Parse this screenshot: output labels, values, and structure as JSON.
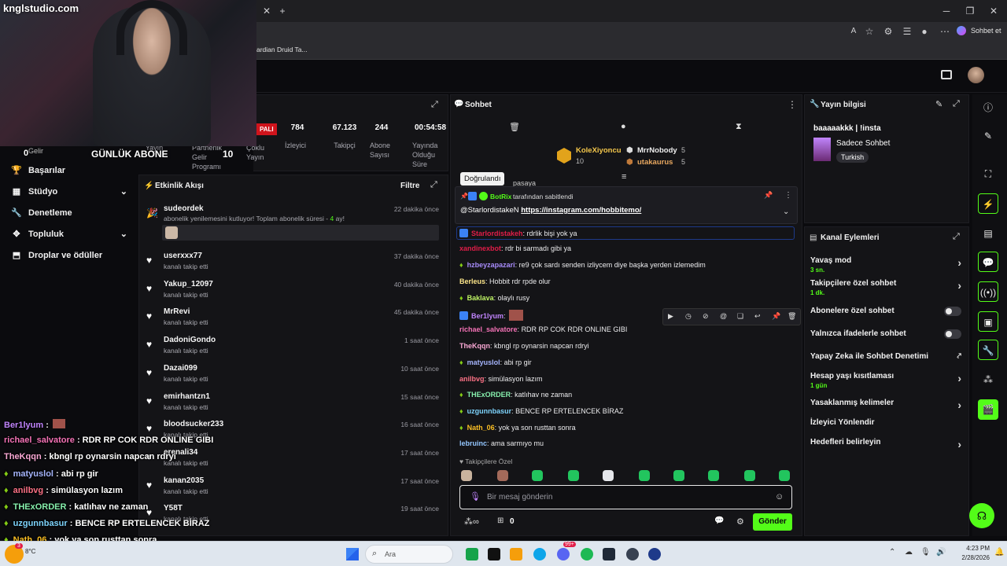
{
  "browser": {
    "bookmark_item": "ardian Druid Ta...",
    "copilot_label": "Sohbet et",
    "window_controls": [
      "minimize-icon",
      "restore-icon",
      "close-icon"
    ]
  },
  "overlay": {
    "brand": "knglstudio.com",
    "gunluk_abone_label": "GÜNLÜK ABONE",
    "gunluk_abone_count": "10",
    "left_counter": "0",
    "chat": [
      {
        "user": "Ber1lyum",
        "text": "",
        "color": "#c084fc"
      },
      {
        "user": "richael_salvatore",
        "text": "RDR RP COK RDR ONLINE GIBI",
        "color": "#f472b6"
      },
      {
        "user": "TheKqqn",
        "text": "kbngl rp oynarsin napcan rdryi",
        "color": "#f9a8d4"
      },
      {
        "user": "matyuslol",
        "text": "abi rp gir",
        "color": "#a5b4fc"
      },
      {
        "user": "anilbvg",
        "text": "simülasyon lazım",
        "color": "#fb7185"
      },
      {
        "user": "THExORDER",
        "text": "katlıhav ne zaman",
        "color": "#86efac"
      },
      {
        "user": "uzgunnbasur",
        "text": "BENCE RP ERTELENCEK BİRAZ",
        "color": "#7dd3fc"
      },
      {
        "user": "Nath_06",
        "text": "yok ya son rusttan sonra",
        "color": "#fbbf24"
      },
      {
        "user": "lebruinc",
        "text": "ama sarmıyo mu",
        "color": "#93c5fd"
      }
    ]
  },
  "stats": {
    "live_badge": "PALI",
    "items": [
      {
        "value": "784",
        "label": "İzleyici"
      },
      {
        "value": "67.123",
        "label": "Takipçi"
      },
      {
        "value": "244",
        "label": "Abone Sayısı"
      },
      {
        "value": "00:54:58",
        "label": "Yayında Olduğu Süre"
      }
    ],
    "partial_labels": [
      "Yayın",
      "Partnerlik Gelir Programı",
      "Çoklu Yayın",
      "Gelir"
    ]
  },
  "sidebar": {
    "items": [
      {
        "label": "Başarılar",
        "icon": "trophy-icon"
      },
      {
        "label": "Stüdyo",
        "icon": "studio-icon",
        "expand": true
      },
      {
        "label": "Denetleme",
        "icon": "wrench-icon"
      },
      {
        "label": "Topluluk",
        "icon": "community-icon",
        "expand": true
      },
      {
        "label": "Droplar ve ödüller",
        "icon": "drops-icon"
      }
    ]
  },
  "activity": {
    "title": "Etkinlik Akışı",
    "filter_label": "Filtre",
    "first": {
      "user": "sudeordek",
      "message": "abonelik yenilemesini kutluyor! Toplam abonelik süresi - ",
      "months": "4",
      "months_suffix": " ay!",
      "time": "22 dakika önce"
    },
    "items": [
      {
        "user": "userxxx77",
        "sub": "kanalı takip etti",
        "time": "37 dakika önce"
      },
      {
        "user": "Yakup_12097",
        "sub": "kanalı takip etti",
        "time": "40 dakika önce"
      },
      {
        "user": "MrRevi",
        "sub": "kanalı takip etti",
        "time": "45 dakika önce"
      },
      {
        "user": "DadoniGondo",
        "sub": "kanalı takip etti",
        "time": "1 saat önce"
      },
      {
        "user": "Dazai099",
        "sub": "kanalı takip etti",
        "time": "10 saat önce"
      },
      {
        "user": "emirhantzn1",
        "sub": "kanalı takip etti",
        "time": "15 saat önce"
      },
      {
        "user": "bloodsucker233",
        "sub": "kanalı takip etti",
        "time": "16 saat önce"
      },
      {
        "user": "erenali34",
        "sub": "kanalı takip etti",
        "time": "17 saat önce"
      },
      {
        "user": "kanan2035",
        "sub": "kanalı takip etti",
        "time": "17 saat önce"
      },
      {
        "user": "Y58T",
        "sub": "kanalı takip etti",
        "time": "19 saat önce"
      }
    ]
  },
  "chat": {
    "title": "Sohbet",
    "leaderboard": [
      {
        "user": "KoleXiyoncu",
        "count": "10"
      },
      {
        "user": "MrrNobody",
        "count": "5"
      },
      {
        "user": "utakaurus",
        "count": "5"
      }
    ],
    "tooltip": "Doğrulandı",
    "pinned": {
      "by": "BotRix",
      "by_suffix": " tarafından sabitlendi",
      "user": "@StarlordistakeN",
      "link": "https://instagram.com/hobbitemo/"
    },
    "partial_message": "pasaya",
    "messages": [
      {
        "user": "Starlordistakeh",
        "text": "rdrlik bişi yok ya",
        "color": "#e11d48"
      },
      {
        "user": "xandinexbot",
        "text": "rdr bi sarmadı gibi ya",
        "color": "#e11d48"
      },
      {
        "user": "hzbeyzapazari",
        "text": "re9 çok sardı senden izliycem diye başka yerden izlemedim",
        "color": "#a78bfa"
      },
      {
        "user": "Berleus",
        "text": "Hobbit rdr rpde olur",
        "color": "#fde68a"
      },
      {
        "user": "Baklava",
        "text": "olaylı rusy",
        "color": "#bef264"
      },
      {
        "user": "Ber1lyum",
        "text": "",
        "color": "#c084fc"
      },
      {
        "user": "richael_salvatore",
        "text": "RDR RP COK RDR ONLINE GIBI",
        "color": "#f472b6"
      },
      {
        "user": "TheKqqn",
        "text": "kbngl rp oynarsin napcan rdryi",
        "color": "#f9a8d4"
      },
      {
        "user": "matyuslol",
        "text": "abi rp gir",
        "color": "#a5b4fc"
      },
      {
        "user": "anilbvg",
        "text": "simülasyon lazım",
        "color": "#fb7185"
      },
      {
        "user": "THExORDER",
        "text": "katlıhav ne zaman",
        "color": "#86efac"
      },
      {
        "user": "uzgunnbasur",
        "text": "BENCE RP ERTELENCEK BİRAZ",
        "color": "#7dd3fc"
      },
      {
        "user": "Nath_06",
        "text": "yok ya son rusttan sonra",
        "color": "#fbbf24"
      },
      {
        "user": "lebruinc",
        "text": "ama sarmıyo mu",
        "color": "#93c5fd"
      }
    ],
    "followers_only": "Takipçilere Özel",
    "input_placeholder": "Bir mesaj gönderin",
    "points": "0",
    "send_label": "Gönder"
  },
  "stream_info": {
    "title": "Yayın bilgisi",
    "stream_title": "baaaaakkk | !insta",
    "category": "Sadece Sohbet",
    "language": "Turkish"
  },
  "channel_actions": {
    "title": "Kanal Eylemleri",
    "items": [
      {
        "label": "Yavaş mod",
        "sub": "3 sn.",
        "control": "chevron"
      },
      {
        "label": "Takipçilere özel sohbet",
        "sub": "1 dk.",
        "control": "chevron"
      },
      {
        "label": "Abonelere özel sohbet",
        "sub": "",
        "control": "toggle"
      },
      {
        "label": "Yalnızca ifadelerle sohbet",
        "sub": "",
        "control": "toggle"
      },
      {
        "label": "Yapay Zeka ile Sohbet Denetimi",
        "sub": "",
        "control": "external"
      },
      {
        "label": "Hesap yaşı kısıtlaması",
        "sub": "1 gün",
        "control": "chevron"
      },
      {
        "label": "Yasaklanmış kelimeler",
        "sub": "",
        "control": "chevron"
      },
      {
        "label": "İzleyici Yönlendir",
        "sub": "",
        "control": "none"
      },
      {
        "label": "Hedefleri belirleyin",
        "sub": "",
        "control": "chevron"
      }
    ]
  },
  "taskbar": {
    "search_placeholder": "Ara",
    "time": "4:23 PM",
    "date": "2/28/2026",
    "weather": "8°C",
    "badge": "3",
    "discord_badge": "99+"
  },
  "colors": {
    "accent": "#53fc18",
    "panel": "#141417",
    "bg": "#0b0b0e"
  }
}
